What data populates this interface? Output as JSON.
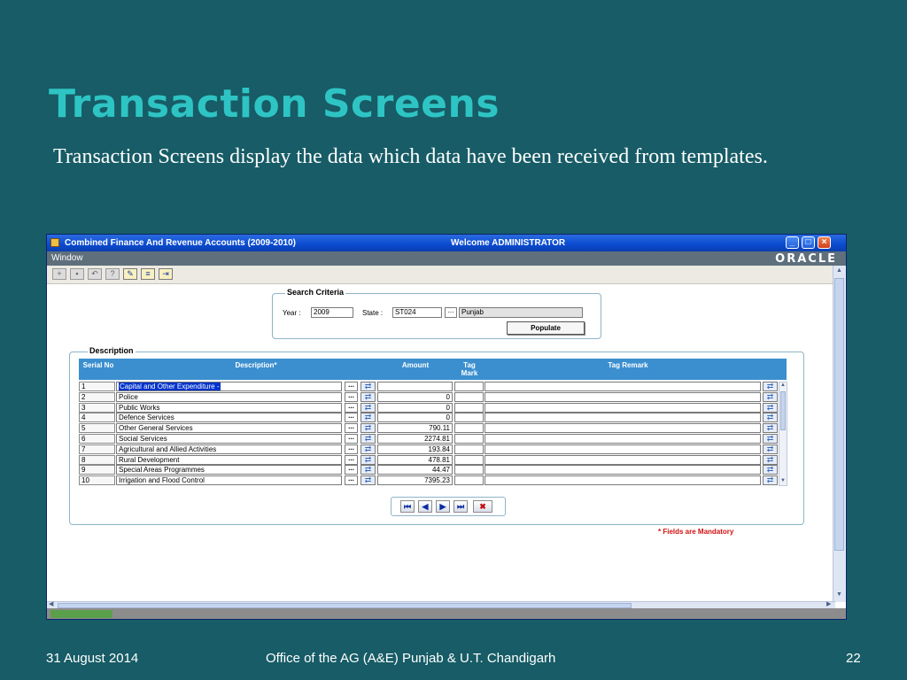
{
  "slide": {
    "title": "Transaction Screens",
    "body": "Transaction  Screens display the data which data have been received from templates.",
    "footer_date": "31 August 2014",
    "footer_office": "Office of the AG (A&E) Punjab & U.T. Chandigarh",
    "footer_page": "22"
  },
  "window": {
    "title": "Combined Finance And Revenue Accounts (2009-2010)",
    "welcome": "Welcome  ADMINISTRATOR",
    "menu_window": "Window",
    "brand": "ORACLE",
    "buttons": [
      "minimize",
      "maximize",
      "close"
    ]
  },
  "search": {
    "legend": "Search Criteria",
    "year_label": "Year :",
    "year_value": "2009",
    "state_label": "State :",
    "state_code": "ST024",
    "state_name": "Punjab",
    "populate_label": "Populate"
  },
  "description": {
    "legend": "Description",
    "headers": {
      "serial": "Serial No",
      "description": "Description*",
      "amount": "Amount",
      "tag_mark": "Tag Mark",
      "tag_remark": "Tag Remark"
    },
    "rows": [
      {
        "serial": "1",
        "description": "Capital and Other Expenditure -",
        "amount": ""
      },
      {
        "serial": "2",
        "description": "Police",
        "amount": "0"
      },
      {
        "serial": "3",
        "description": "Public Works",
        "amount": "0"
      },
      {
        "serial": "4",
        "description": "Defence Services",
        "amount": "0"
      },
      {
        "serial": "5",
        "description": "Other General Services",
        "amount": "790.11"
      },
      {
        "serial": "6",
        "description": "Social Services",
        "amount": "2274.81"
      },
      {
        "serial": "7",
        "description": "Agricultural and Allied Activities",
        "amount": "193.84"
      },
      {
        "serial": "8",
        "description": "Rural Development",
        "amount": "478.81"
      },
      {
        "serial": "9",
        "description": "Special Areas Programmes",
        "amount": "44.47"
      },
      {
        "serial": "10",
        "description": "Irrigation and Flood Control",
        "amount": "7395.23"
      }
    ],
    "mandatory_note": "* Fields are Mandatory"
  },
  "icons": {
    "lov": "ellipsis-icon",
    "swap": "swap-arrows-icon",
    "nav": [
      "first-record-icon",
      "previous-record-icon",
      "next-record-icon",
      "last-record-icon",
      "delete-record-icon"
    ]
  },
  "colors": {
    "slide_bg": "#175c66",
    "title": "#2ec4c4",
    "grid_header": "#3b8fcf",
    "titlebar": "#0a4ad0",
    "mandatory": "#d01010"
  }
}
